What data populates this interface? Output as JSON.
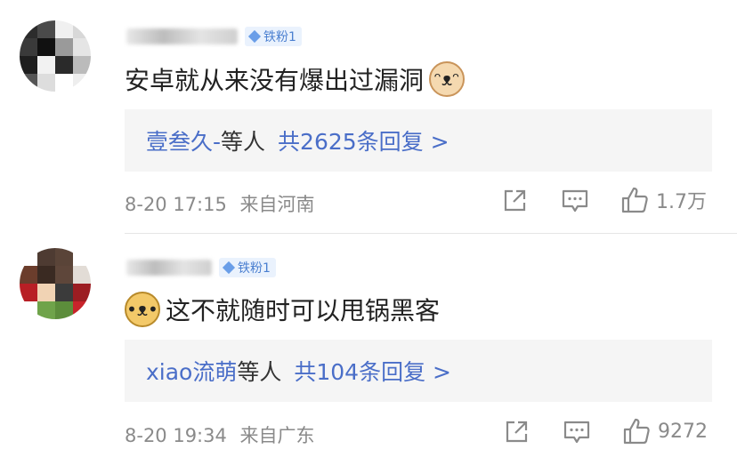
{
  "comments": [
    {
      "username": "",
      "badge": "铁粉1",
      "text": "安卓就从来没有爆出过漏洞",
      "emoji": "cat-emoji",
      "replies": {
        "names": "壹叁久-",
        "suffix": "等人",
        "count_text": "共2625条回复 >"
      },
      "time": "8-20 17:15",
      "location": "来自河南",
      "likes": "1.7万"
    },
    {
      "username": "",
      "badge": "铁粉1",
      "text": "这不就随时可以甩锅黑客",
      "emoji": "doge-emoji",
      "replies": {
        "names": "xiao流萌",
        "suffix": "等人",
        "count_text": "共104条回复 >"
      },
      "time": "8-20 19:34",
      "location": "来自广东",
      "likes": "9272"
    }
  ],
  "icons": {
    "share": "share-icon",
    "comment": "comment-icon",
    "like": "thumbs-up-icon"
  },
  "colors": {
    "link": "#4a6ec8",
    "meta": "#8a8a8a",
    "badge_bg": "#eaf2fd",
    "badge_text": "#4a7fd0",
    "reply_bg": "#f5f5f5"
  }
}
